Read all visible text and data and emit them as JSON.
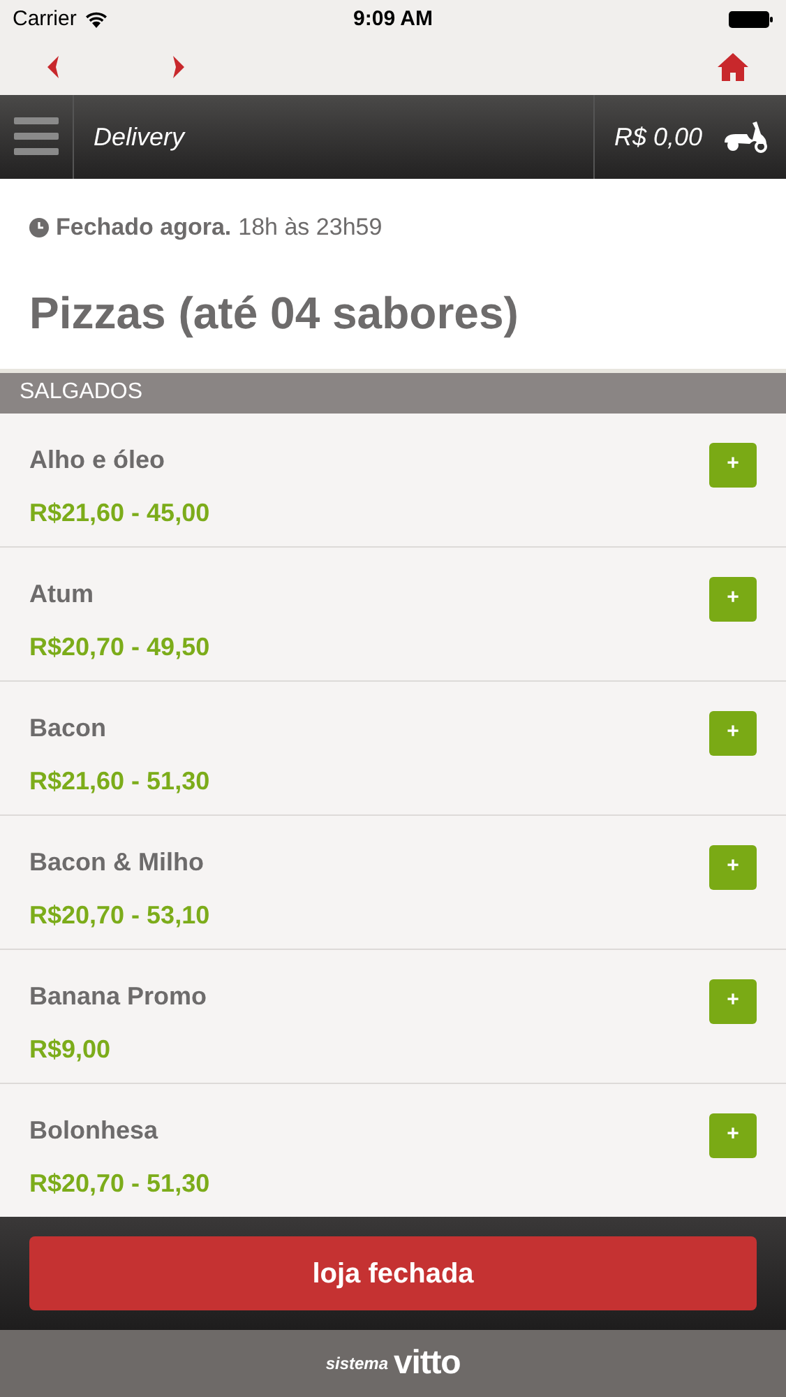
{
  "status_bar": {
    "carrier": "Carrier",
    "time": "9:09 AM"
  },
  "header": {
    "title": "Delivery",
    "cart_total": "R$ 0,00"
  },
  "store": {
    "status": "Fechado agora.",
    "hours": "18h às 23h59",
    "category": "Pizzas (até 04 sabores)"
  },
  "section": "SALGADOS",
  "items": [
    {
      "name": "Alho e óleo",
      "price": "R$21,60 - 45,00",
      "add": "+"
    },
    {
      "name": "Atum",
      "price": "R$20,70 - 49,50",
      "add": "+"
    },
    {
      "name": "Bacon",
      "price": "R$21,60 - 51,30",
      "add": "+"
    },
    {
      "name": "Bacon & Milho",
      "price": "R$20,70 - 53,10",
      "add": "+"
    },
    {
      "name": "Banana Promo",
      "price": "R$9,00",
      "add": "+"
    },
    {
      "name": "Bolonhesa",
      "price": "R$20,70 - 51,30",
      "add": "+"
    }
  ],
  "action_button": "loja fechada",
  "footer": {
    "prefix": "sistema",
    "brand": "vitto"
  }
}
